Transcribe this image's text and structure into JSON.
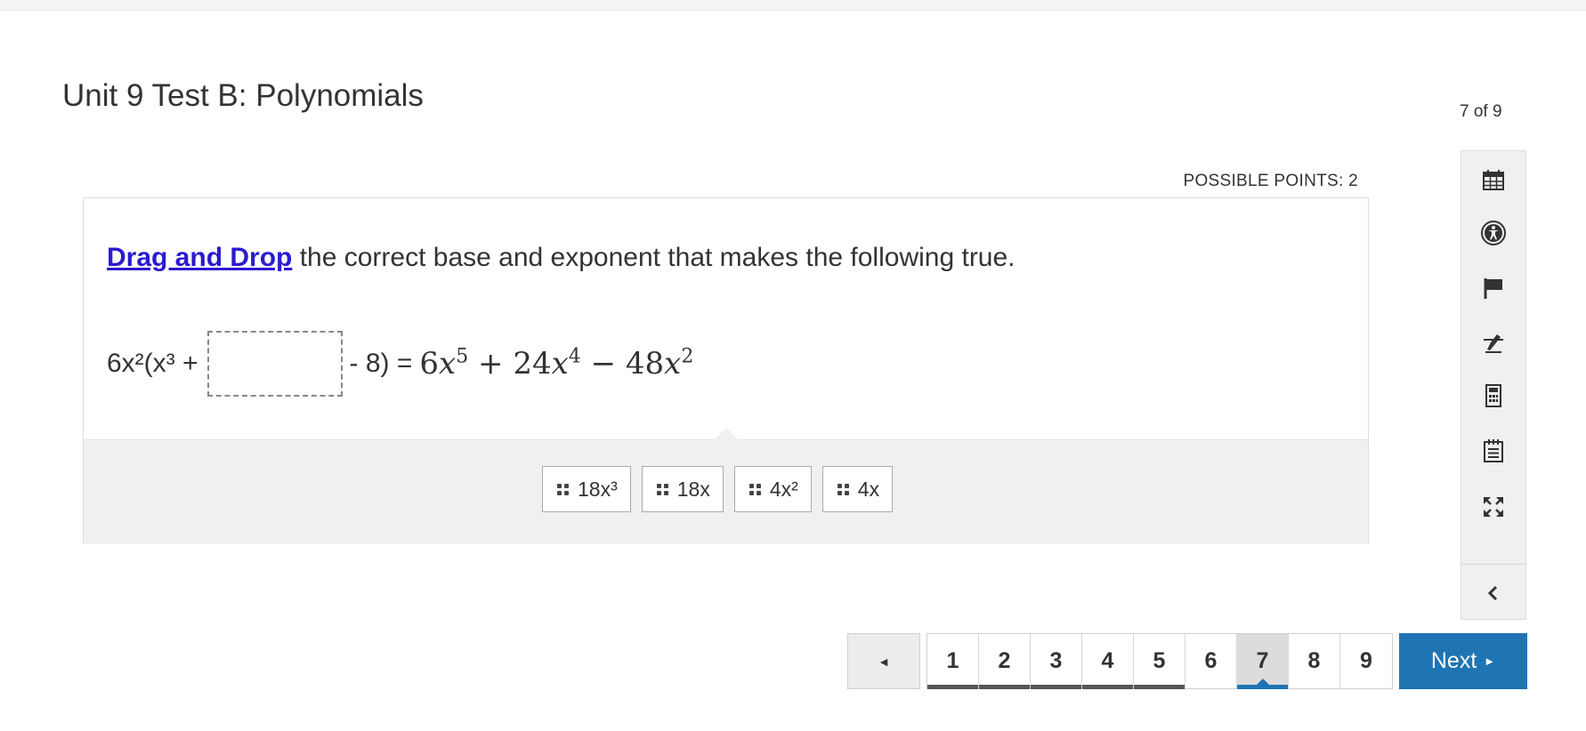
{
  "header": {
    "title": "Unit 9 Test B: Polynomials",
    "counter": "7 of 9",
    "points": "POSSIBLE POINTS: 2"
  },
  "question": {
    "link_text": "Drag and Drop",
    "prompt_rest": " the correct base and exponent that makes the following true.",
    "equation_left": "6x²(x³ +",
    "equation_mid": "- 8) =",
    "equation_right": {
      "term1_coef": "6",
      "term1_var": "x",
      "term1_exp": "5",
      "op1": "+",
      "term2_coef": "24",
      "term2_var": "x",
      "term2_exp": "4",
      "op2": "−",
      "term3_coef": "48",
      "term3_var": "x",
      "term3_exp": "2"
    }
  },
  "answer_bank": [
    {
      "label": "18x³"
    },
    {
      "label": "18x"
    },
    {
      "label": "4x²"
    },
    {
      "label": "4x"
    }
  ],
  "toolbar": {
    "icons": [
      "calendar-icon",
      "accessibility-icon",
      "flag-icon",
      "no-highlight-icon",
      "calculator-icon",
      "notepad-icon",
      "fullscreen-icon",
      "collapse-icon"
    ]
  },
  "pagination": {
    "prev_symbol": "◄",
    "pages": [
      "1",
      "2",
      "3",
      "4",
      "5",
      "6",
      "7",
      "8",
      "9"
    ],
    "current": "7",
    "answered": [
      "1",
      "2",
      "3",
      "4",
      "5"
    ],
    "next_label": "Next",
    "next_symbol": "►"
  },
  "colors": {
    "accent": "#1f74b4",
    "link": "#2a1ad0",
    "bank_bg": "#f0f0f0"
  }
}
